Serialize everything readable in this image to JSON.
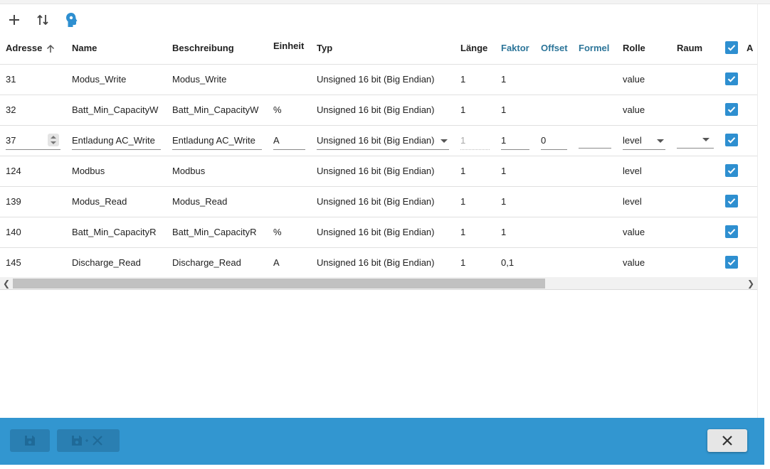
{
  "toolbar": {
    "add_icon": "plus-icon",
    "sort_icon": "sort-arrows-icon",
    "ai_icon": "head-icon"
  },
  "table": {
    "columns": {
      "address": "Adresse",
      "name": "Name",
      "description": "Beschreibung",
      "unit": "Einheit",
      "type": "Typ",
      "length": "Länge",
      "factor": "Faktor",
      "offset": "Offset",
      "formula": "Formel",
      "role": "Rolle",
      "room": "Raum",
      "last": "A"
    },
    "rows": [
      {
        "address": "31",
        "name": "Modus_Write",
        "description": "Modus_Write",
        "unit": "",
        "type": "Unsigned 16 bit (Big Endian)",
        "length": "1",
        "factor": "1",
        "offset": "",
        "formula": "",
        "role": "value",
        "room": "",
        "checked": true
      },
      {
        "address": "32",
        "name": "Batt_Min_CapacityW",
        "description": "Batt_Min_CapacityW",
        "unit": "%",
        "type": "Unsigned 16 bit (Big Endian)",
        "length": "1",
        "factor": "1",
        "offset": "",
        "formula": "",
        "role": "value",
        "room": "",
        "checked": true
      },
      {
        "address": "37",
        "name": "Entladung AC_Write",
        "description": "Entladung AC_Write",
        "unit": "A",
        "type": "Unsigned 16 bit (Big Endian)",
        "length": "1",
        "factor": "1",
        "offset": "0",
        "formula": "",
        "role": "level",
        "room": "",
        "checked": true,
        "editing": true
      },
      {
        "address": "124",
        "name": "Modbus",
        "description": "Modbus",
        "unit": "",
        "type": "Unsigned 16 bit (Big Endian)",
        "length": "1",
        "factor": "1",
        "offset": "",
        "formula": "",
        "role": "level",
        "room": "",
        "checked": true
      },
      {
        "address": "139",
        "name": "Modus_Read",
        "description": "Modus_Read",
        "unit": "",
        "type": "Unsigned 16 bit (Big Endian)",
        "length": "1",
        "factor": "1",
        "offset": "",
        "formula": "",
        "role": "level",
        "room": "",
        "checked": true
      },
      {
        "address": "140",
        "name": "Batt_Min_CapacityR",
        "description": "Batt_Min_CapacityR",
        "unit": "%",
        "type": "Unsigned 16 bit (Big Endian)",
        "length": "1",
        "factor": "1",
        "offset": "",
        "formula": "",
        "role": "value",
        "room": "",
        "checked": true
      },
      {
        "address": "145",
        "name": "Discharge_Read",
        "description": "Discharge_Read",
        "unit": "A",
        "type": "Unsigned 16 bit (Big Endian)",
        "length": "1",
        "factor": "0,1",
        "offset": "",
        "formula": "",
        "role": "value",
        "room": "",
        "checked": true
      }
    ]
  },
  "scrollbar": {
    "position_fraction": 0.0
  },
  "footer": {
    "save_icon": "save-icon",
    "save_close_icon": "save-close-icon",
    "close_icon": "close-icon"
  },
  "colors": {
    "accent": "#3296d0",
    "checkbox": "#2e8fd0",
    "header_link": "#2c7599"
  }
}
